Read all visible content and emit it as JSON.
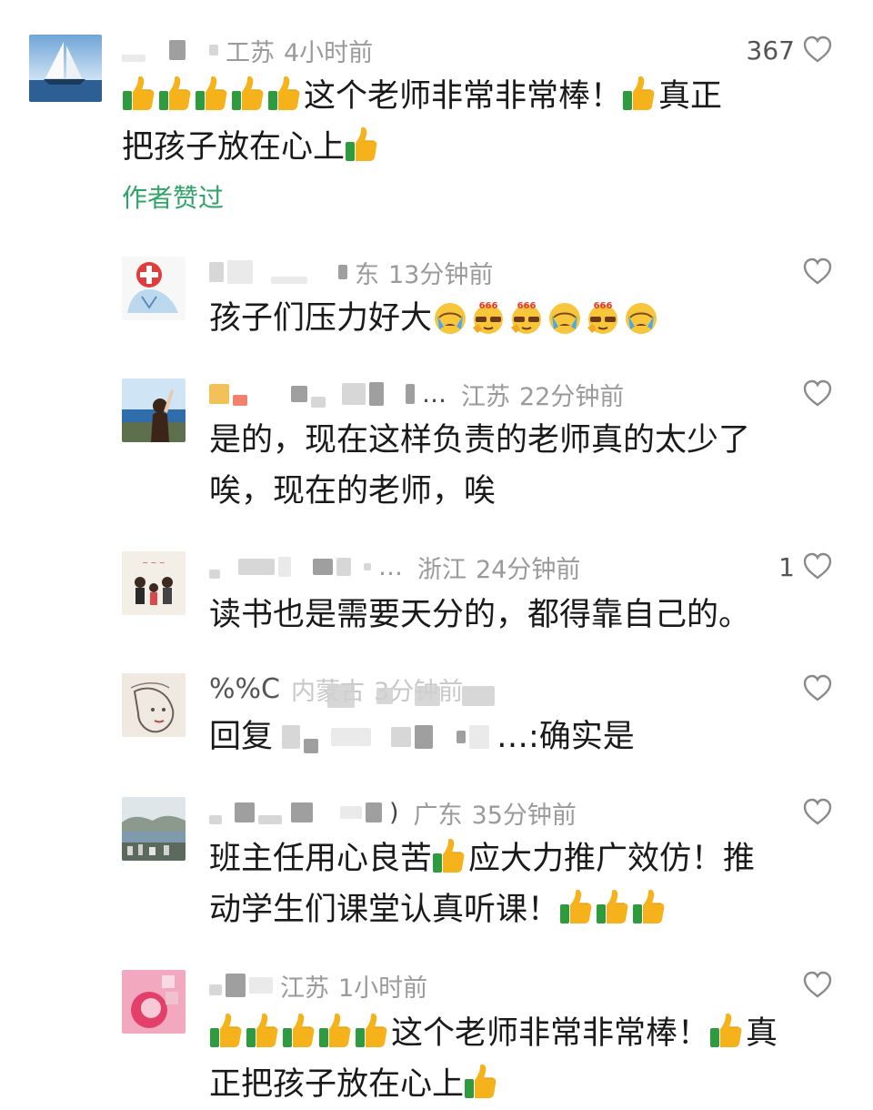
{
  "comments": [
    {
      "location": "江苏",
      "loc_partial": "工苏",
      "time": "4小时前",
      "likes": "367",
      "text_line1": "这个老师非常非常棒！",
      "text_line1b": "真正",
      "text_line2": "把孩子放在心上",
      "author_liked": "作者赞过",
      "avatar_icon": "sailboat-avatar-icon"
    },
    {
      "location": "东",
      "time": "13分钟前",
      "likes": "",
      "text": "孩子们压力好大",
      "emoji_text": "666",
      "avatar_icon": "red-cross-avatar-icon"
    },
    {
      "location": "江苏",
      "time": "22分钟前",
      "name_suffix": "…",
      "likes": "",
      "text_line1": "是的，现在这样负责的老师真的太少了",
      "text_line2": "唉，现在的老师，唉",
      "avatar_icon": "seaside-girl-avatar-icon"
    },
    {
      "location": "浙江",
      "time": "24分钟前",
      "name_suffix": "…",
      "likes": "1",
      "text": "读书也是需要天分的，都得靠自己的。",
      "avatar_icon": "cartoon-kids-avatar-icon"
    },
    {
      "name": "%%C",
      "location": "内蒙古",
      "time": "3分钟前",
      "likes": "",
      "reply_prefix": "回复",
      "reply_suffix": "…:确实是",
      "avatar_icon": "sketch-portrait-avatar-icon"
    },
    {
      "name_suffix": ")",
      "location": "广东",
      "time": "35分钟前",
      "likes": "",
      "text_line1a": "班主任用心良苦",
      "text_line1b": "应大力推广效仿！推",
      "text_line2": "动学生们课堂认真听课！",
      "avatar_icon": "coastal-city-avatar-icon"
    },
    {
      "location": "江苏",
      "time": "1小时前",
      "likes": "",
      "text_line1": "这个老师非常非常棒！",
      "text_line1b": "真",
      "text_line2": "正把孩子放在心上",
      "avatar_icon": "pink-flower-avatar-icon"
    }
  ],
  "colors": {
    "author_liked": "#2fa467",
    "meta_gray": "#9a9a9a",
    "text": "#1a1a1a"
  }
}
